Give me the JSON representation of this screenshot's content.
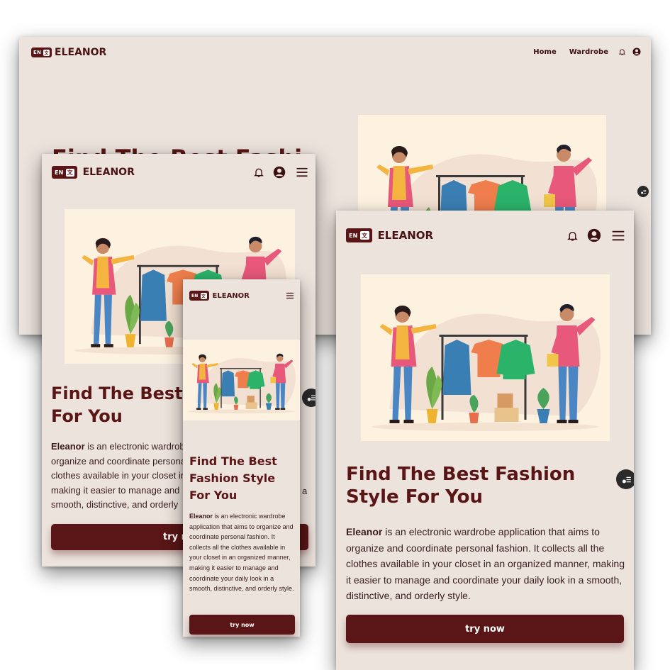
{
  "brand": {
    "lang": "EN",
    "lang_icon": "translate-icon",
    "name": "ELEANOR"
  },
  "nav": {
    "home": "Home",
    "wardrobe": "Wardrobe"
  },
  "hero": {
    "title": "Find The Best Fashion Style For You",
    "title_desktop_partial": "Find The Best Fashi",
    "title_tablet_partial_1": "Find The Best F",
    "title_tablet_partial_2": "For You",
    "title_mobile_1": "Find The Best",
    "title_mobile_2": "Fashion Style",
    "title_mobile_3": "For You",
    "desc_strong": "Eleanor",
    "desc_rest": " is an electronic wardrobe application that aims to organize and coordinate personal fashion. It collects all the clothes available in your closet in an organized manner, making it easier to manage and coordinate your daily look in a smooth, distinctive, and orderly style.",
    "tablet_desc_line1": " is an electronic wardrob",
    "tablet_desc_line2": "organize and coordinate persona",
    "tablet_desc_line3": "clothes available in your closet in",
    "tablet_desc_line4": "making it easier to manage and",
    "tablet_desc_line5": "smooth, distinctive, and orderly",
    "tablet_desc_a": "a",
    "cta": "try now",
    "cta_partial": "try n"
  },
  "colors": {
    "brand": "#5a1616",
    "bg": "#ede3dd",
    "image_bg": "#fdf1e0"
  }
}
